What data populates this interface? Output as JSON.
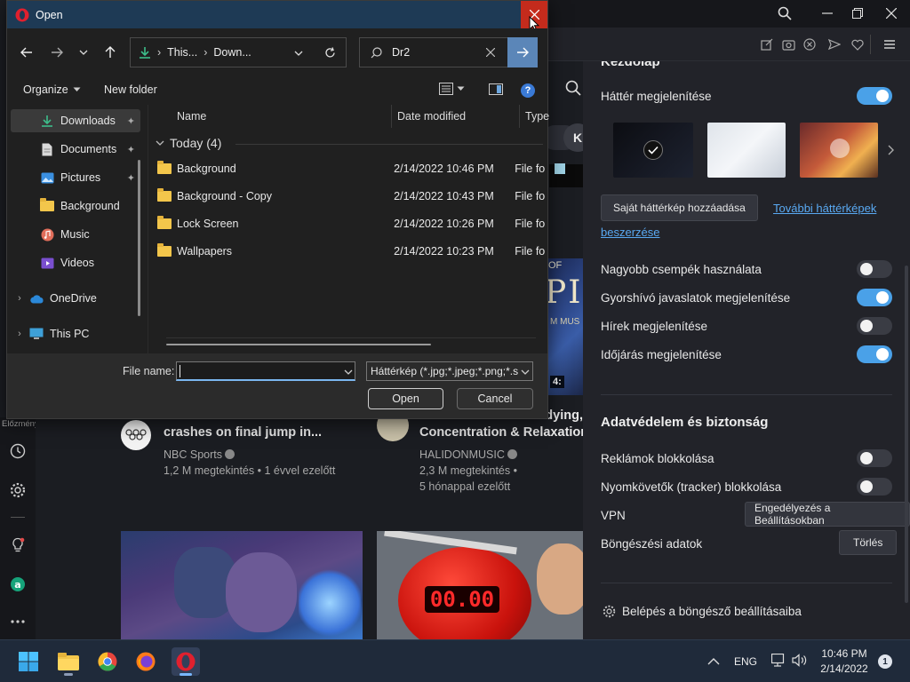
{
  "browser": {
    "settings": {
      "section_title": "Kezdőlap",
      "bg_show": "Háttér megjelenítése",
      "add_bg_button": "Saját háttérkép hozzáadása",
      "more_bg_link_1": "További háttérképek",
      "more_bg_link_2": "beszerzése",
      "toggles": [
        {
          "label": "Nagyobb csempék használata",
          "on": false
        },
        {
          "label": "Gyorshívó javaslatok megjelenítése",
          "on": true
        },
        {
          "label": "Hírek megjelenítése",
          "on": false
        },
        {
          "label": "Időjárás megjelenítése",
          "on": true
        }
      ],
      "privacy_title": "Adatvédelem és biztonság",
      "privacy_toggles": [
        {
          "label": "Reklámok blokkolása",
          "on": false
        },
        {
          "label": "Nyomkövetők (tracker) blokkolása",
          "on": false
        }
      ],
      "vpn_label": "VPN",
      "vpn_button": "Engedélyezés a Beállításokban",
      "browsing_data_label": "Böngészési adatok",
      "clear_button": "Törlés",
      "open_settings": "Belépés a böngésző beállításaiba"
    },
    "content": {
      "history_label": "Előzmények",
      "card1_title_line1": "crashes on final jump in...",
      "card1_channel": "NBC Sports",
      "card1_meta": "1,2 M megtekintés • 1 évvel ezelőtt",
      "card2_title_line0": "dying,",
      "card2_title_line1": "Concentration & Relaxation",
      "card2_channel": "HALIDONMUSIC",
      "card2_meta1": "2,3 M megtekintés •",
      "card2_meta2": "5 hónappal ezelőtt",
      "thumb_overlay": "OF",
      "thumb_big": "PIN",
      "thumb_sub": "M MUS",
      "thumb_duration": "4:",
      "timer_text": "00.00",
      "search_chip": "K"
    }
  },
  "dialog": {
    "title": "Open",
    "breadcrumb": [
      "This...",
      "Down..."
    ],
    "search_value": "Dr2",
    "organize": "Organize",
    "new_folder": "New folder",
    "nav": [
      {
        "label": "Downloads",
        "pinned": true
      },
      {
        "label": "Documents",
        "pinned": true
      },
      {
        "label": "Pictures",
        "pinned": true
      },
      {
        "label": "Background",
        "pinned": false
      },
      {
        "label": "Music",
        "pinned": false
      },
      {
        "label": "Videos",
        "pinned": false
      },
      {
        "label": "OneDrive",
        "pinned": false
      },
      {
        "label": "This PC",
        "pinned": false
      }
    ],
    "columns": {
      "name": "Name",
      "date": "Date modified",
      "type": "Type"
    },
    "group_label": "Today (4)",
    "files": [
      {
        "name": "Background",
        "date": "2/14/2022 10:46 PM",
        "type": "File fo"
      },
      {
        "name": "Background - Copy",
        "date": "2/14/2022 10:43 PM",
        "type": "File fo"
      },
      {
        "name": "Lock Screen",
        "date": "2/14/2022 10:26 PM",
        "type": "File fo"
      },
      {
        "name": "Wallpapers",
        "date": "2/14/2022 10:23 PM",
        "type": "File fo"
      }
    ],
    "file_name_label": "File name:",
    "file_name_value": "",
    "file_type_value": "Háttérkép (*.jpg;*.jpeg;*.png;*.s",
    "open_button": "Open",
    "cancel_button": "Cancel"
  },
  "taskbar": {
    "language": "ENG",
    "time": "10:46 PM",
    "date": "2/14/2022",
    "notification_count": "1"
  },
  "colors": {
    "accent": "#4aa1e8",
    "dialog_title": "#1e3a55",
    "close_red": "#c42b1c"
  }
}
